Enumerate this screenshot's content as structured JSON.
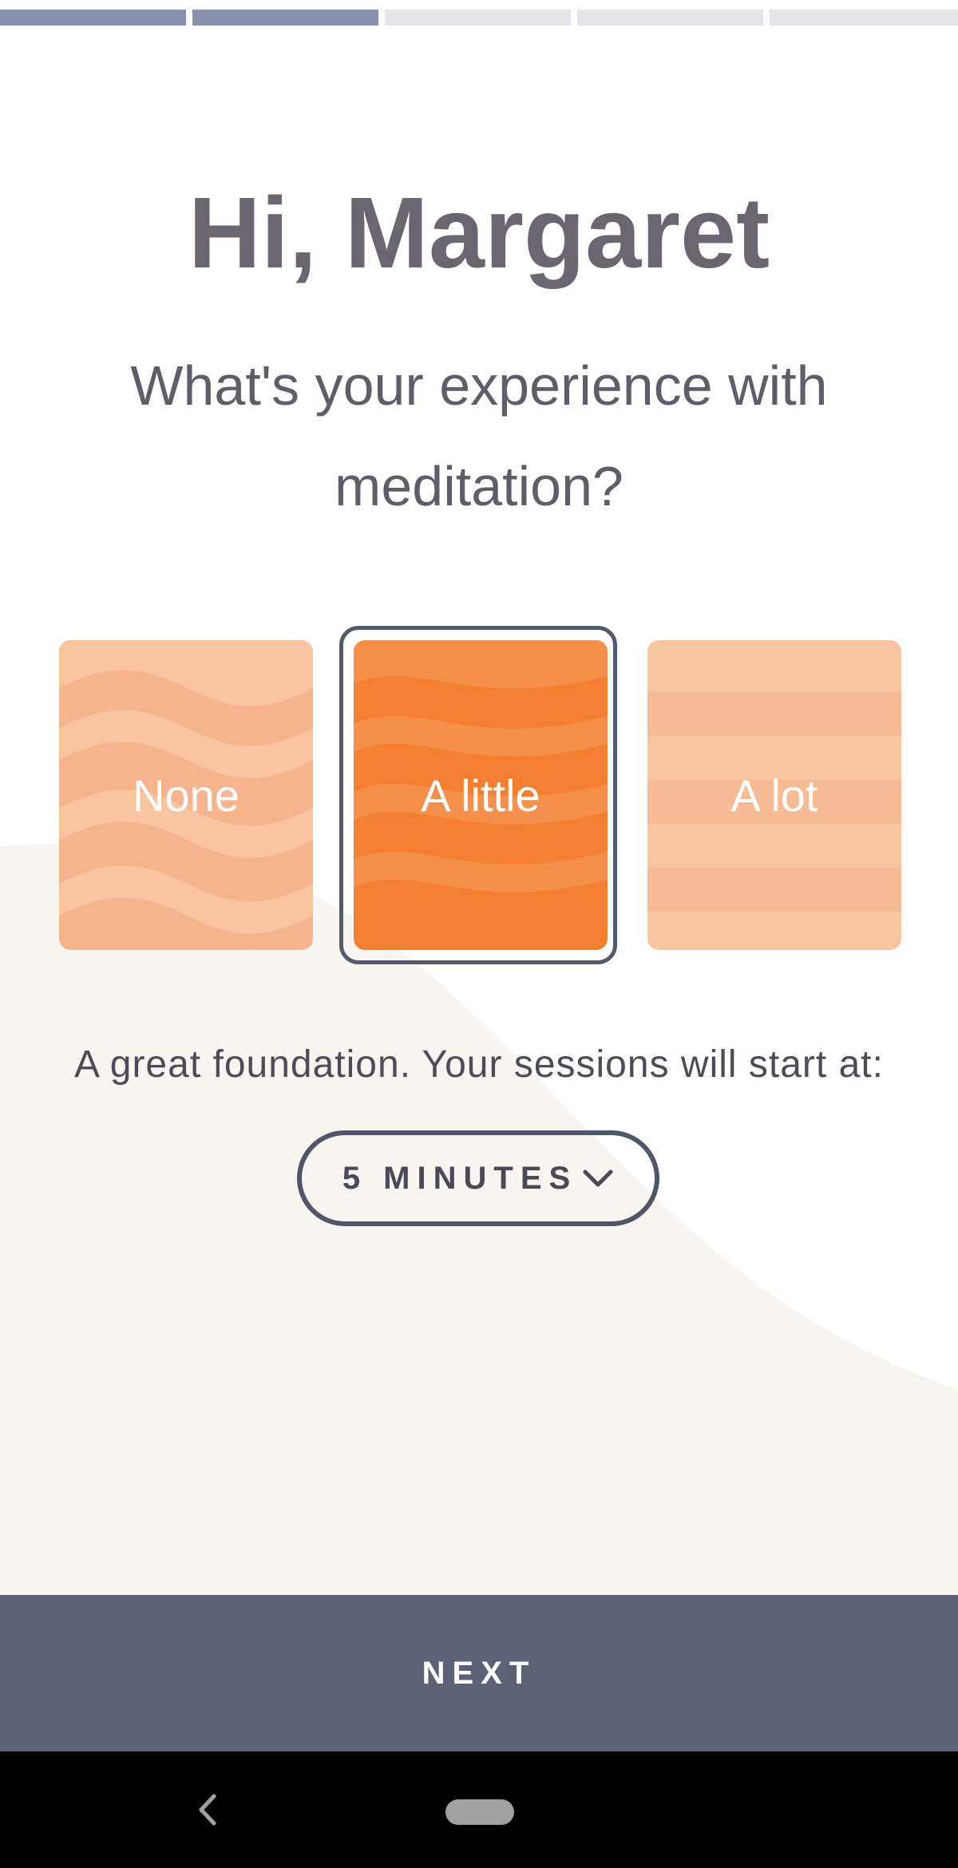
{
  "progress": {
    "total_steps": 5,
    "completed_steps": 2
  },
  "greeting": "Hi, Margaret",
  "question": "What's your experience with meditation?",
  "options": [
    {
      "label": "None",
      "selected": false
    },
    {
      "label": "A little",
      "selected": true
    },
    {
      "label": "A lot",
      "selected": false
    }
  ],
  "feedback": "A great foundation. Your sessions will start at:",
  "duration": {
    "value": "5 MINUTES",
    "icon": "chevron-down-icon"
  },
  "next_button": "NEXT",
  "nav": {
    "back_icon": "back-chevron-icon",
    "home_icon": "home-pill-icon"
  },
  "colors": {
    "accent": "#f47f31",
    "accent_light": "#f7b48c",
    "accent_pale": "#f9c5a0",
    "primary_dark": "#5c6175",
    "progress_done": "#8a91ae",
    "progress_todo": "#e6e4ea",
    "background_curve": "#f8f5f1"
  }
}
